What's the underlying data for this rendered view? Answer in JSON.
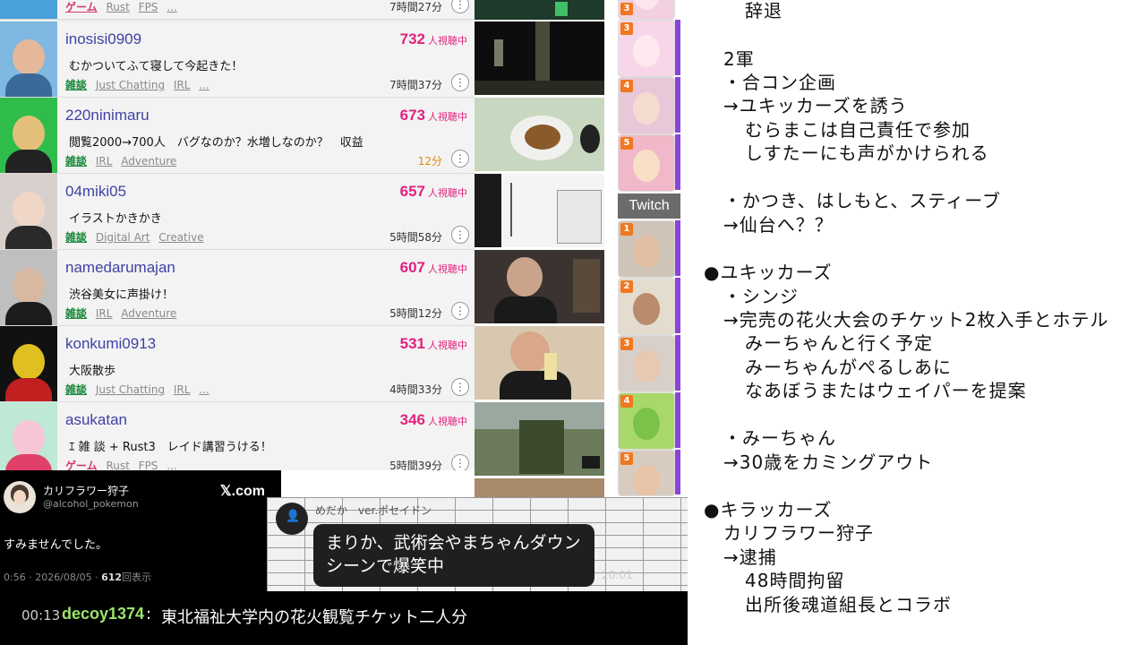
{
  "streams": [
    {
      "name": "",
      "title": "",
      "categories": [
        "ゲーム"
      ],
      "tags": [
        "Rust",
        "FPS",
        "..."
      ],
      "viewers": "",
      "viewers_label": "",
      "duration": "7時間27分"
    },
    {
      "name": "inosisi0909",
      "title": "むかついてふて寝して今起きた！",
      "categories": [
        "雑談"
      ],
      "tags": [
        "Just Chatting",
        "IRL",
        "..."
      ],
      "viewers": "732",
      "viewers_label": "人視聴中",
      "duration": "7時間37分"
    },
    {
      "name": "220ninimaru",
      "title": "閲覧2000→700人　バグなのか？水増しなのか？　収益",
      "categories": [
        "雑談"
      ],
      "tags": [
        "IRL",
        "Adventure"
      ],
      "viewers": "673",
      "viewers_label": "人視聴中",
      "duration": "12分"
    },
    {
      "name": "04miki05",
      "title": "イラストかきかき",
      "categories": [
        "雑談"
      ],
      "tags": [
        "Digital Art",
        "Creative"
      ],
      "viewers": "657",
      "viewers_label": "人視聴中",
      "duration": "5時間58分"
    },
    {
      "name": "namedarumajan",
      "title": "渋谷美女に声掛け！",
      "categories": [
        "雑談"
      ],
      "tags": [
        "IRL",
        "Adventure"
      ],
      "viewers": "607",
      "viewers_label": "人視聴中",
      "duration": "5時間12分"
    },
    {
      "name": "konkumi0913",
      "title": "大阪散歩",
      "categories": [
        "雑談"
      ],
      "tags": [
        "Just Chatting",
        "IRL",
        "..."
      ],
      "viewers": "531",
      "viewers_label": "人視聴中",
      "duration": "4時間33分"
    },
    {
      "name": "asukatan",
      "title": "ｴ 雑 談 + Rust3　レイド講習うける！",
      "categories": [
        "ゲーム"
      ],
      "tags": [
        "Rust",
        "FPS",
        "..."
      ],
      "viewers": "346",
      "viewers_label": "人視聴中",
      "duration": "5時間39分"
    }
  ],
  "more_icon": "⋮",
  "ranking": {
    "twitch_label": "Twitch",
    "top_numbers": [
      "3",
      "4",
      "5"
    ],
    "twitch_numbers": [
      "1",
      "2",
      "3",
      "4",
      "5"
    ]
  },
  "tweet": {
    "name": "カリフラワー狩子",
    "handle": "@alcohol_pokemon",
    "logo": "𝕏.com",
    "body": "すみませんでした。",
    "meta_time": "0:56 · 2026/08/05 · ",
    "meta_views": "612",
    "meta_views_label": "回表示"
  },
  "chat_overlay": {
    "username": "めだか　ver.ポセイドン",
    "message": "まりか、武術会やまちゃんダウンシーンで爆笑中",
    "time": "20:01"
  },
  "ticker": {
    "time": "00:13",
    "user": "decoy1374",
    "separator": ":",
    "message": "東北福祉大学内の花火観覧チケット二人分"
  },
  "notes": [
    "辞退",
    "2軍",
    "・合コン企画",
    "→ユキッカーズを誘う",
    "むらまこは自己責任で参加",
    "しすたーにも声がかけられる",
    "・かつき、はしもと、スティーブ",
    "→仙台へ？？",
    "●ユキッカーズ",
    "・シンジ",
    "→完売の花火大会のチケット2枚入手とホテル",
    "みーちゃんと行く予定",
    "みーちゃんがぺるしあに",
    "なあぼうまたはウェイパーを提案",
    "・みーちゃん",
    "→30歳をカミングアウト",
    "●キラッカーズ",
    "カリフラワー狩子",
    "→逮捕",
    "48時間拘留",
    "出所後魂道組長とコラボ"
  ],
  "colors": {
    "username": "#4141a6",
    "viewers": "#e0227f",
    "category_chat": "#1a8a3a",
    "category_game": "#d43a6a",
    "rank_badge": "#f07820",
    "twitch_strip": "#8a45d8",
    "ticker_user": "#9be36a"
  }
}
